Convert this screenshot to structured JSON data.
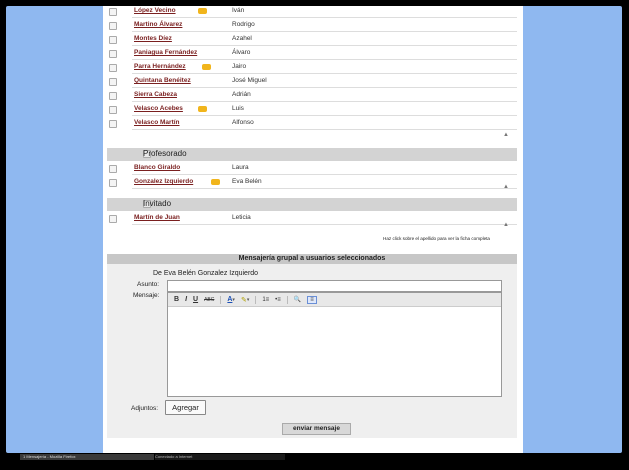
{
  "students": [
    {
      "surname": "López Vecino",
      "first": "Iván",
      "badge": true
    },
    {
      "surname": "Martino Álvarez",
      "first": "Rodrigo",
      "badge": false
    },
    {
      "surname": "Montes Díez",
      "first": "Azahel",
      "badge": false
    },
    {
      "surname": "Paniagua Fernández",
      "first": "Álvaro",
      "badge": false
    },
    {
      "surname": "Parra Hernández",
      "first": "Jairo",
      "badge": true
    },
    {
      "surname": "Quintana Benéitez",
      "first": "José Miguel",
      "badge": false
    },
    {
      "surname": "Sierra Cabeza",
      "first": "Adrián",
      "badge": false
    },
    {
      "surname": "Velasco Acebes",
      "first": "Luis",
      "badge": true
    },
    {
      "surname": "Velasco Martín",
      "first": "Alfonso",
      "badge": false
    }
  ],
  "profesorado": {
    "title": "Profesorado",
    "members": [
      {
        "surname": "Blanco Giraldo",
        "first": "Laura",
        "badge": false
      },
      {
        "surname": "Gonzalez Izquierdo",
        "first": "Eva Belén",
        "badge": true
      }
    ]
  },
  "invitado": {
    "title": "Invitado",
    "members": [
      {
        "surname": "Martín de Juan",
        "first": "Leticia",
        "badge": false
      }
    ]
  },
  "hint": "Haz click sobre el apellido para ver la ficha completa",
  "messaging": {
    "header": "Mensajería grupal a usuarios seleccionados",
    "from": "De Eva Belén Gonzalez Izquierdo",
    "subject_label": "Asunto:",
    "subject_value": "",
    "message_label": "Mensaje:",
    "message_value": "",
    "attachments_label": "Adjuntos:",
    "add_button": "Agregar",
    "send_button": "enviar mensaje"
  },
  "toolbar": {
    "bold": "B",
    "italic": "I",
    "underline": "U",
    "strike": "ABC",
    "font_color": "A",
    "highlight": "✎",
    "ordered_list": "1≡",
    "unordered_list": "•≡",
    "find": "🔍",
    "html": "≡"
  },
  "taskbar": {
    "item1": "1 Mensajería - Mozilla Firefox",
    "item2": "Conectado a Internet"
  },
  "colors": {
    "background": "#8fb8f0",
    "link": "#7a1f1f",
    "section": "#d3d3d3"
  }
}
